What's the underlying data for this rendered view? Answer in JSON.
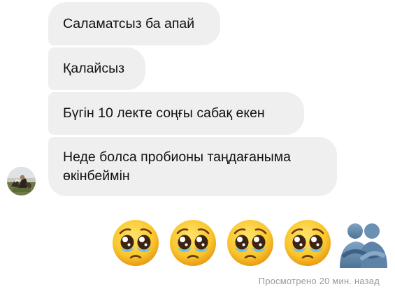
{
  "messages": [
    {
      "text": "Саламатсыз ба апай"
    },
    {
      "text": "Қалайсыз"
    },
    {
      "text": "Бүгін 10 лекте соңғы сабақ екен"
    },
    {
      "text": "Неде болса пробионы таңдағаныма өкінбеймін"
    }
  ],
  "reactions": {
    "emoji": [
      "pleading-face",
      "pleading-face",
      "pleading-face",
      "pleading-face"
    ],
    "last": "people-hugging"
  },
  "status": {
    "seen_label": "Просмотрено 20 мин. назад"
  },
  "colors": {
    "bubble_bg": "#efefef",
    "text": "#111111",
    "status_text": "#9a9a9a",
    "background": "#ffffff"
  }
}
